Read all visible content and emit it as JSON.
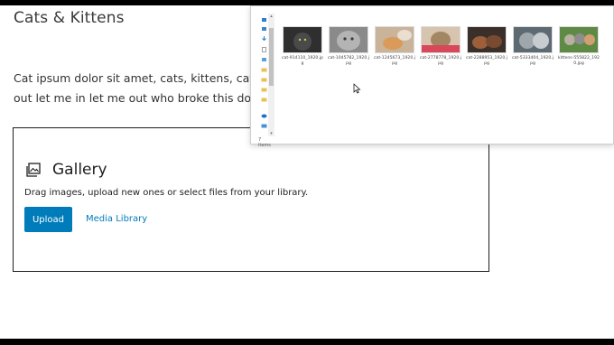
{
  "post": {
    "title": "Cats & Kittens",
    "paragraph_line1": "Cat ipsum dolor sit amet, cats, kittens, cats,",
    "paragraph_line2": "out let me in let me out who broke this door"
  },
  "gallery": {
    "title": "Gallery",
    "instructions": "Drag images, upload new ones or select files from your library.",
    "upload_label": "Upload",
    "media_library_label": "Media Library",
    "accent_color": "#007cba"
  },
  "explorer": {
    "status": "7 items",
    "files": [
      {
        "name": "cat-914110_1920.jpg"
      },
      {
        "name": "cat-1045782_1920.jpg"
      },
      {
        "name": "cat-1245673_1920.jpg"
      },
      {
        "name": "cat-2778778_1920.jpg"
      },
      {
        "name": "cat-2288953_1920.jpg"
      },
      {
        "name": "cat-5333404_1920.jpg"
      },
      {
        "name": "kittens-555822_1920.jpg"
      }
    ]
  }
}
